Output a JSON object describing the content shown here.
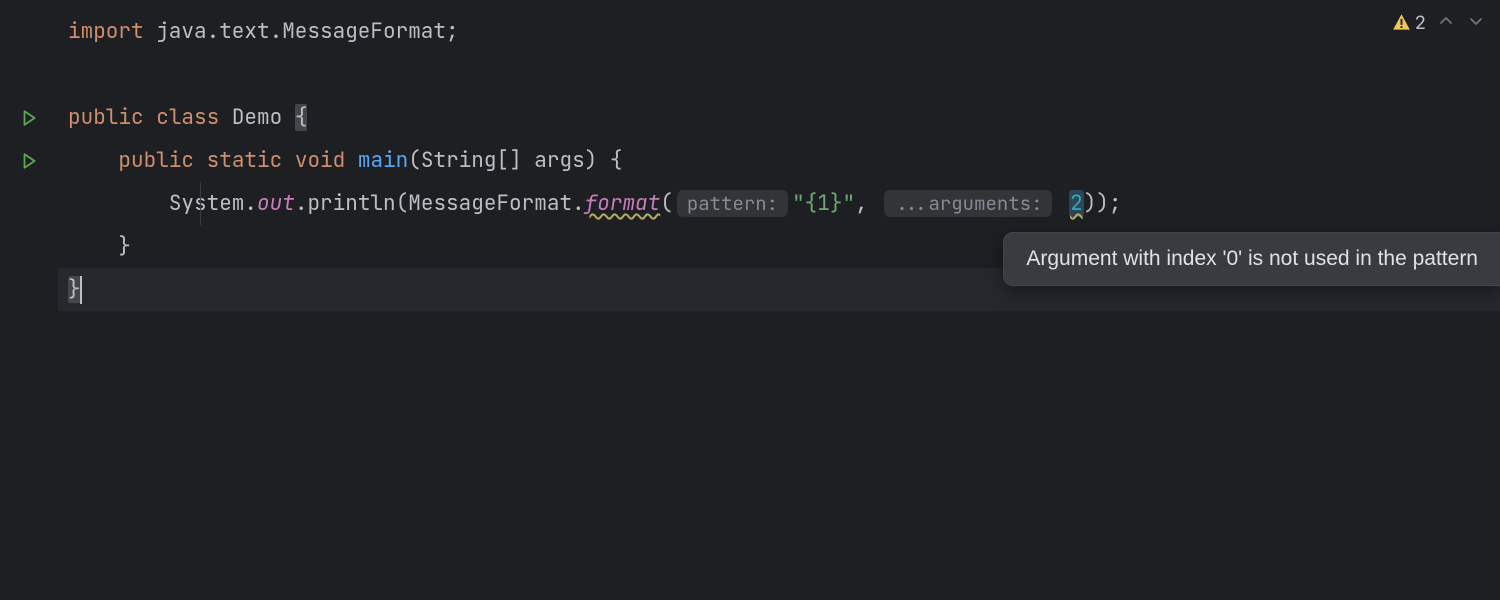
{
  "inspection": {
    "warning_count": "2"
  },
  "code": {
    "line1": {
      "kw_import": "import",
      "pkg": " java.text.MessageFormat;"
    },
    "line3": {
      "kw_public": "public",
      "kw_class": "class",
      "cls_name": "Demo",
      "brace": "{"
    },
    "line4": {
      "kw_public": "public",
      "kw_static": "static",
      "kw_void": "void",
      "method": "main",
      "params": "(String[] args) {"
    },
    "line5": {
      "receiver": "System.",
      "out": "out",
      "dot": ".",
      "println": "println",
      "open": "(MessageFormat.",
      "format": "format",
      "open2": "(",
      "hint_pattern": "pattern:",
      "pattern_str": "\"{1}\"",
      "comma": ", ",
      "hint_args": "...arguments:",
      "arg_val": "2",
      "close": "));"
    },
    "line6": {
      "brace": "}"
    },
    "line7": {
      "brace": "}"
    }
  },
  "tooltip": {
    "text": "Argument with index '0' is not used in the pattern"
  }
}
